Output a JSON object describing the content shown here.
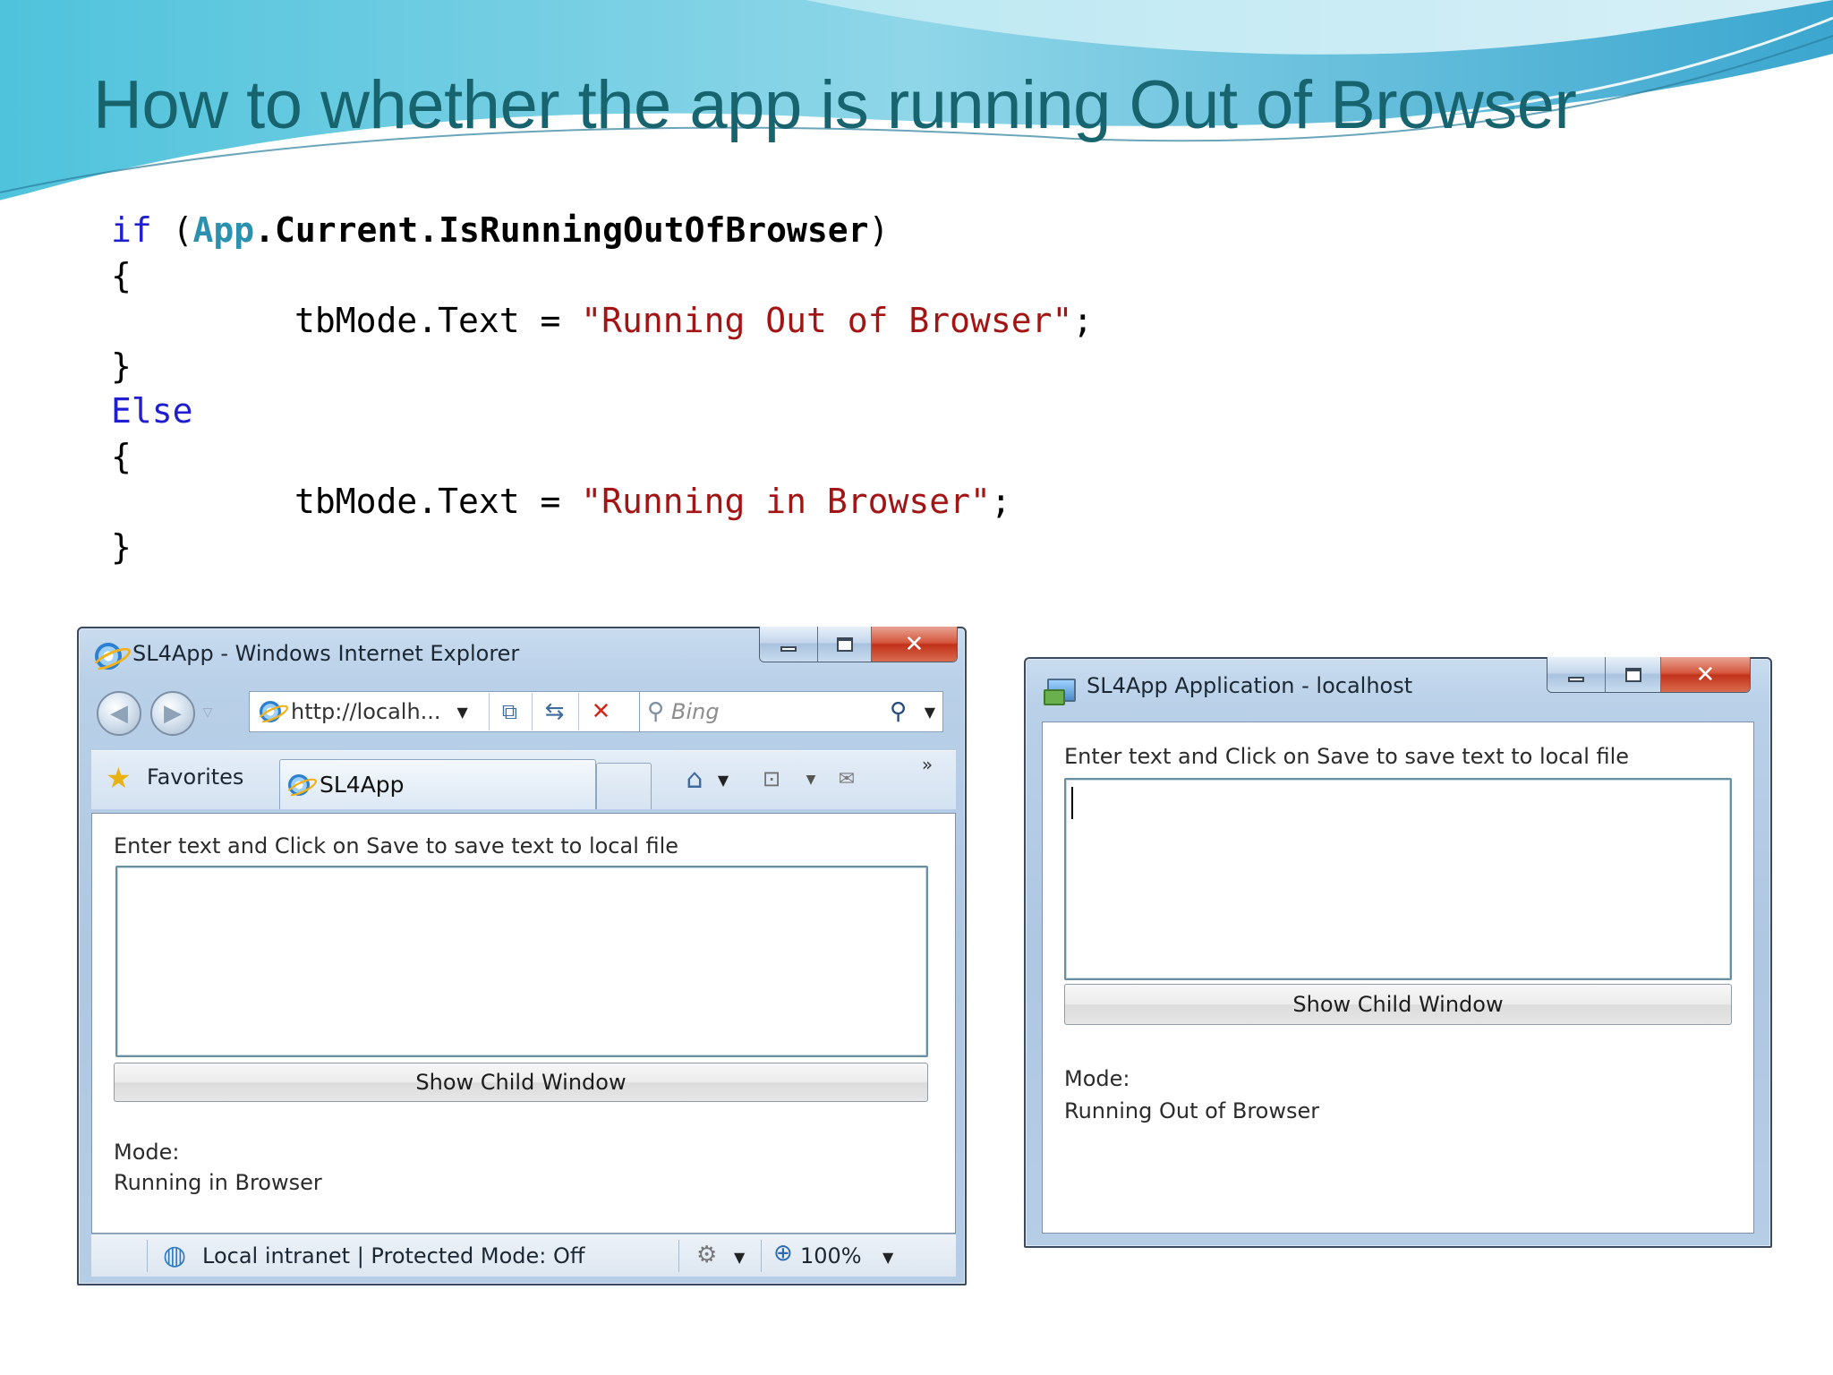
{
  "slide": {
    "title": "How to whether the app is running Out of Browser"
  },
  "code": {
    "line1": {
      "kw": "if",
      "open": " (",
      "type": "App",
      "member": ".Current.IsRunningOutOfBrowser",
      "close": ")"
    },
    "line2": "{",
    "line3": {
      "lhs": "tbMode.Text = ",
      "str": "\"Running Out of Browser\"",
      "end": ";"
    },
    "line4": "}",
    "line5": "Else",
    "line6": "{",
    "line7": {
      "lhs": "tbMode.Text = ",
      "str": "\"Running in Browser\"",
      "end": ";"
    },
    "line8": "}"
  },
  "ie_window": {
    "title": "SL4App - Windows Internet Explorer",
    "address": "http://localh...",
    "search_placeholder": "Bing",
    "favorites_label": "Favorites",
    "tab_label": "SL4App",
    "chevron": "»",
    "content": {
      "instruction": "Enter text and Click on Save to save text to local file",
      "button_label": "Show Child Window",
      "mode_label": "Mode:",
      "mode_value": "Running in Browser"
    },
    "status": {
      "zone": "Local intranet | Protected Mode: Off",
      "zoom": "100%"
    }
  },
  "oob_window": {
    "title": "SL4App Application - localhost",
    "content": {
      "instruction": "Enter text and Click on Save to save text to local file",
      "button_label": "Show Child Window",
      "mode_label": "Mode:",
      "mode_value": "Running Out of Browser"
    }
  },
  "icons": {
    "back": "back-arrow-icon",
    "forward": "forward-arrow-icon",
    "compat": "compatibility-view-icon",
    "refresh": "refresh-icon",
    "stop": "stop-icon",
    "search": "search-icon",
    "home": "home-icon",
    "feeds": "rss-feed-icon",
    "mail": "mail-icon",
    "zone": "globe-icon",
    "zoom": "zoom-icon"
  },
  "colors": {
    "title": "#17646f",
    "keyword": "#1f1fd0",
    "type": "#2b91af",
    "string": "#a31515",
    "close_button": "#c2321a"
  }
}
